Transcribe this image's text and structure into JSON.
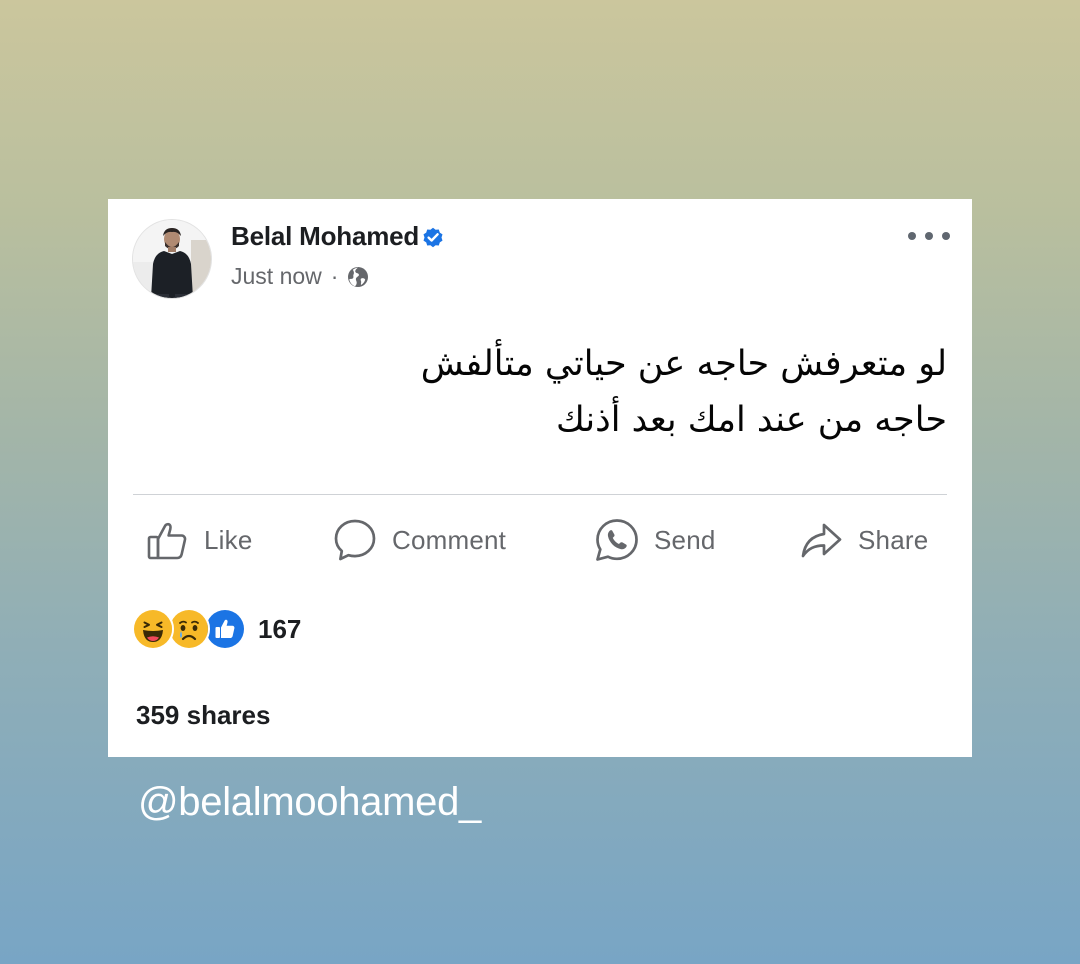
{
  "post": {
    "author": "Belal Mohamed",
    "timestamp": "Just now",
    "separator": "·",
    "audience_icon": "globe-icon",
    "verified_icon": "verified-badge-icon",
    "verified_color": "#1b74e4",
    "menu_icon": "more-options-icon",
    "text_lines": [
      "لو متعرفش حاجه عن حياتي متألفش",
      "حاجه من عند امك بعد أذنك"
    ]
  },
  "actions": {
    "like": "Like",
    "comment": "Comment",
    "send": "Send",
    "share": "Share"
  },
  "stats": {
    "reaction_icons": [
      "haha-icon",
      "sad-icon",
      "like-icon"
    ],
    "reactions_count": "167",
    "shares": "359 shares"
  },
  "overlay": {
    "handle": "@belalmoohamed_"
  },
  "colors": {
    "icon_gray": "#65676b",
    "like_blue": "#1b74e4",
    "emoji_yellow": "#f7b928",
    "background_top": "#cbc69d",
    "background_bottom": "#78a5c5"
  }
}
